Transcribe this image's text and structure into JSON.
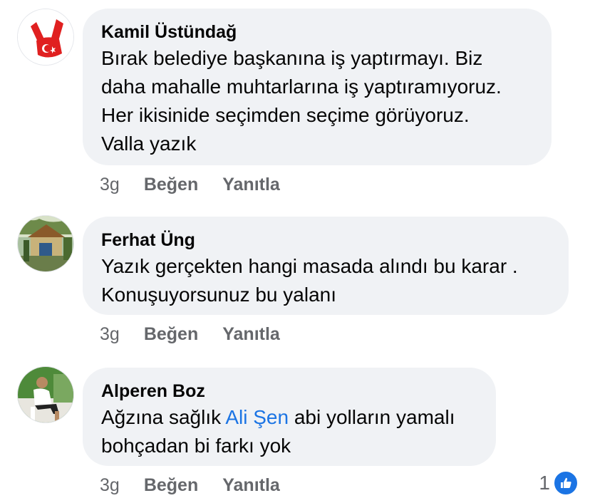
{
  "comments": [
    {
      "author": "Kamil Üstündağ",
      "lines": [
        "Bırak belediye başkanına iş yaptırmayı. Biz",
        "daha mahalle muhtarlarına iş yaptıramıyoruz.",
        "Her ikisinide seçimden seçime görüyoruz.",
        "Valla yazık"
      ],
      "time": "3g",
      "like_label": "Beğen",
      "reply_label": "Yanıtla"
    },
    {
      "author": "Ferhat Üng",
      "lines": [
        "Yazık gerçekten hangi masada alındı bu karar .",
        "Konuşuyorsunuz bu yalanı"
      ],
      "time": "3g",
      "like_label": "Beğen",
      "reply_label": "Yanıtla"
    },
    {
      "author": "Alperen Boz",
      "line1_before": "Ağzına sağlık ",
      "line1_mention": "Ali Şen",
      "line1_after": " abi yolların yamalı",
      "line2": "bohçadan bi farkı yok",
      "time": "3g",
      "like_label": "Beğen",
      "reply_label": "Yanıtla",
      "reaction_count": "1",
      "reaction_icon": "thumbs-up-icon"
    }
  ],
  "colors": {
    "bubble": "#f0f2f5",
    "meta": "#65676b",
    "mention": "#1b74e4",
    "like_badge": "#1b74e4"
  }
}
